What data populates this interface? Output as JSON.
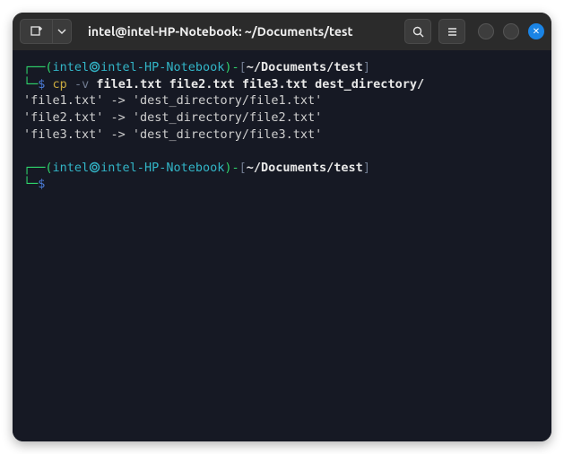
{
  "titlebar": {
    "title": "intel@intel-HP-Notebook: ~/Documents/test"
  },
  "colors": {
    "bg": "#161924",
    "green": "#2fd46c",
    "cyan": "#32b5c7",
    "white": "#e8e8e8",
    "gray": "#6f7a8f",
    "blue": "#4b7bd6",
    "yellow": "#c8a93f"
  },
  "prompt1": {
    "lparen": "(",
    "user": "intel",
    "at_host": "intel-HP-Notebook",
    "rparen": ")-",
    "lbracket": "[",
    "tilde": "~",
    "path": "/Documents/test",
    "rbracket": "]",
    "dollar": "$",
    "cmd_prefix": "cp ",
    "cmd_flag": "-v",
    "cmd_args": " file1.txt file2.txt file3.txt dest_directory/"
  },
  "output": [
    "'file1.txt' -> 'dest_directory/file1.txt'",
    "'file2.txt' -> 'dest_directory/file2.txt'",
    "'file3.txt' -> 'dest_directory/file3.txt'"
  ],
  "prompt2": {
    "lparen": "(",
    "user": "intel",
    "at_host": "intel-HP-Notebook",
    "rparen": ")-",
    "lbracket": "[",
    "tilde": "~",
    "path": "/Documents/test",
    "rbracket": "]",
    "dollar": "$"
  }
}
